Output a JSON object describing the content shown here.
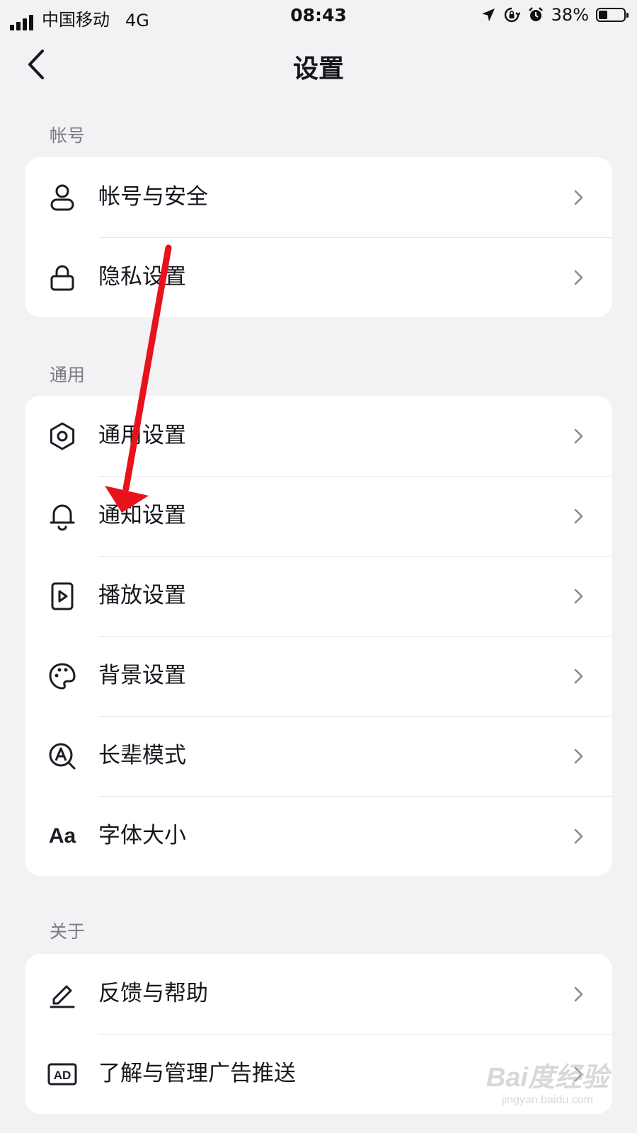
{
  "status_bar": {
    "carrier": "中国移动",
    "network": "4G",
    "time": "08:43",
    "battery": "38%",
    "icons": [
      "signal-icon",
      "location-icon",
      "rotation-lock-icon",
      "alarm-icon",
      "battery-icon"
    ]
  },
  "header": {
    "title": "设置",
    "back_icon": "chevron-left-icon"
  },
  "sections": [
    {
      "label": "帐号",
      "items": [
        {
          "label": "帐号与安全",
          "icon": "user-icon"
        },
        {
          "label": "隐私设置",
          "icon": "lock-icon"
        }
      ]
    },
    {
      "label": "通用",
      "items": [
        {
          "label": "通用设置",
          "icon": "gear-icon"
        },
        {
          "label": "通知设置",
          "icon": "bell-icon"
        },
        {
          "label": "播放设置",
          "icon": "play-icon"
        },
        {
          "label": "背景设置",
          "icon": "palette-icon"
        },
        {
          "label": "长辈模式",
          "icon": "elder-mode-icon"
        },
        {
          "label": "字体大小",
          "icon": "font-size-icon",
          "icon_text": "Aa"
        }
      ]
    },
    {
      "label": "关于",
      "items": [
        {
          "label": "反馈与帮助",
          "icon": "edit-icon"
        },
        {
          "label": "了解与管理广告推送",
          "icon": "ad-icon",
          "icon_text": "AD"
        }
      ]
    }
  ],
  "annotation": {
    "arrow_color": "#e8121c"
  },
  "watermark": {
    "main": "Bai度经验",
    "sub": "jingyan.baidu.com"
  },
  "colors": {
    "background": "#f2f2f4",
    "card": "#ffffff",
    "text": "#16161e",
    "section_label": "#7a7a80"
  }
}
